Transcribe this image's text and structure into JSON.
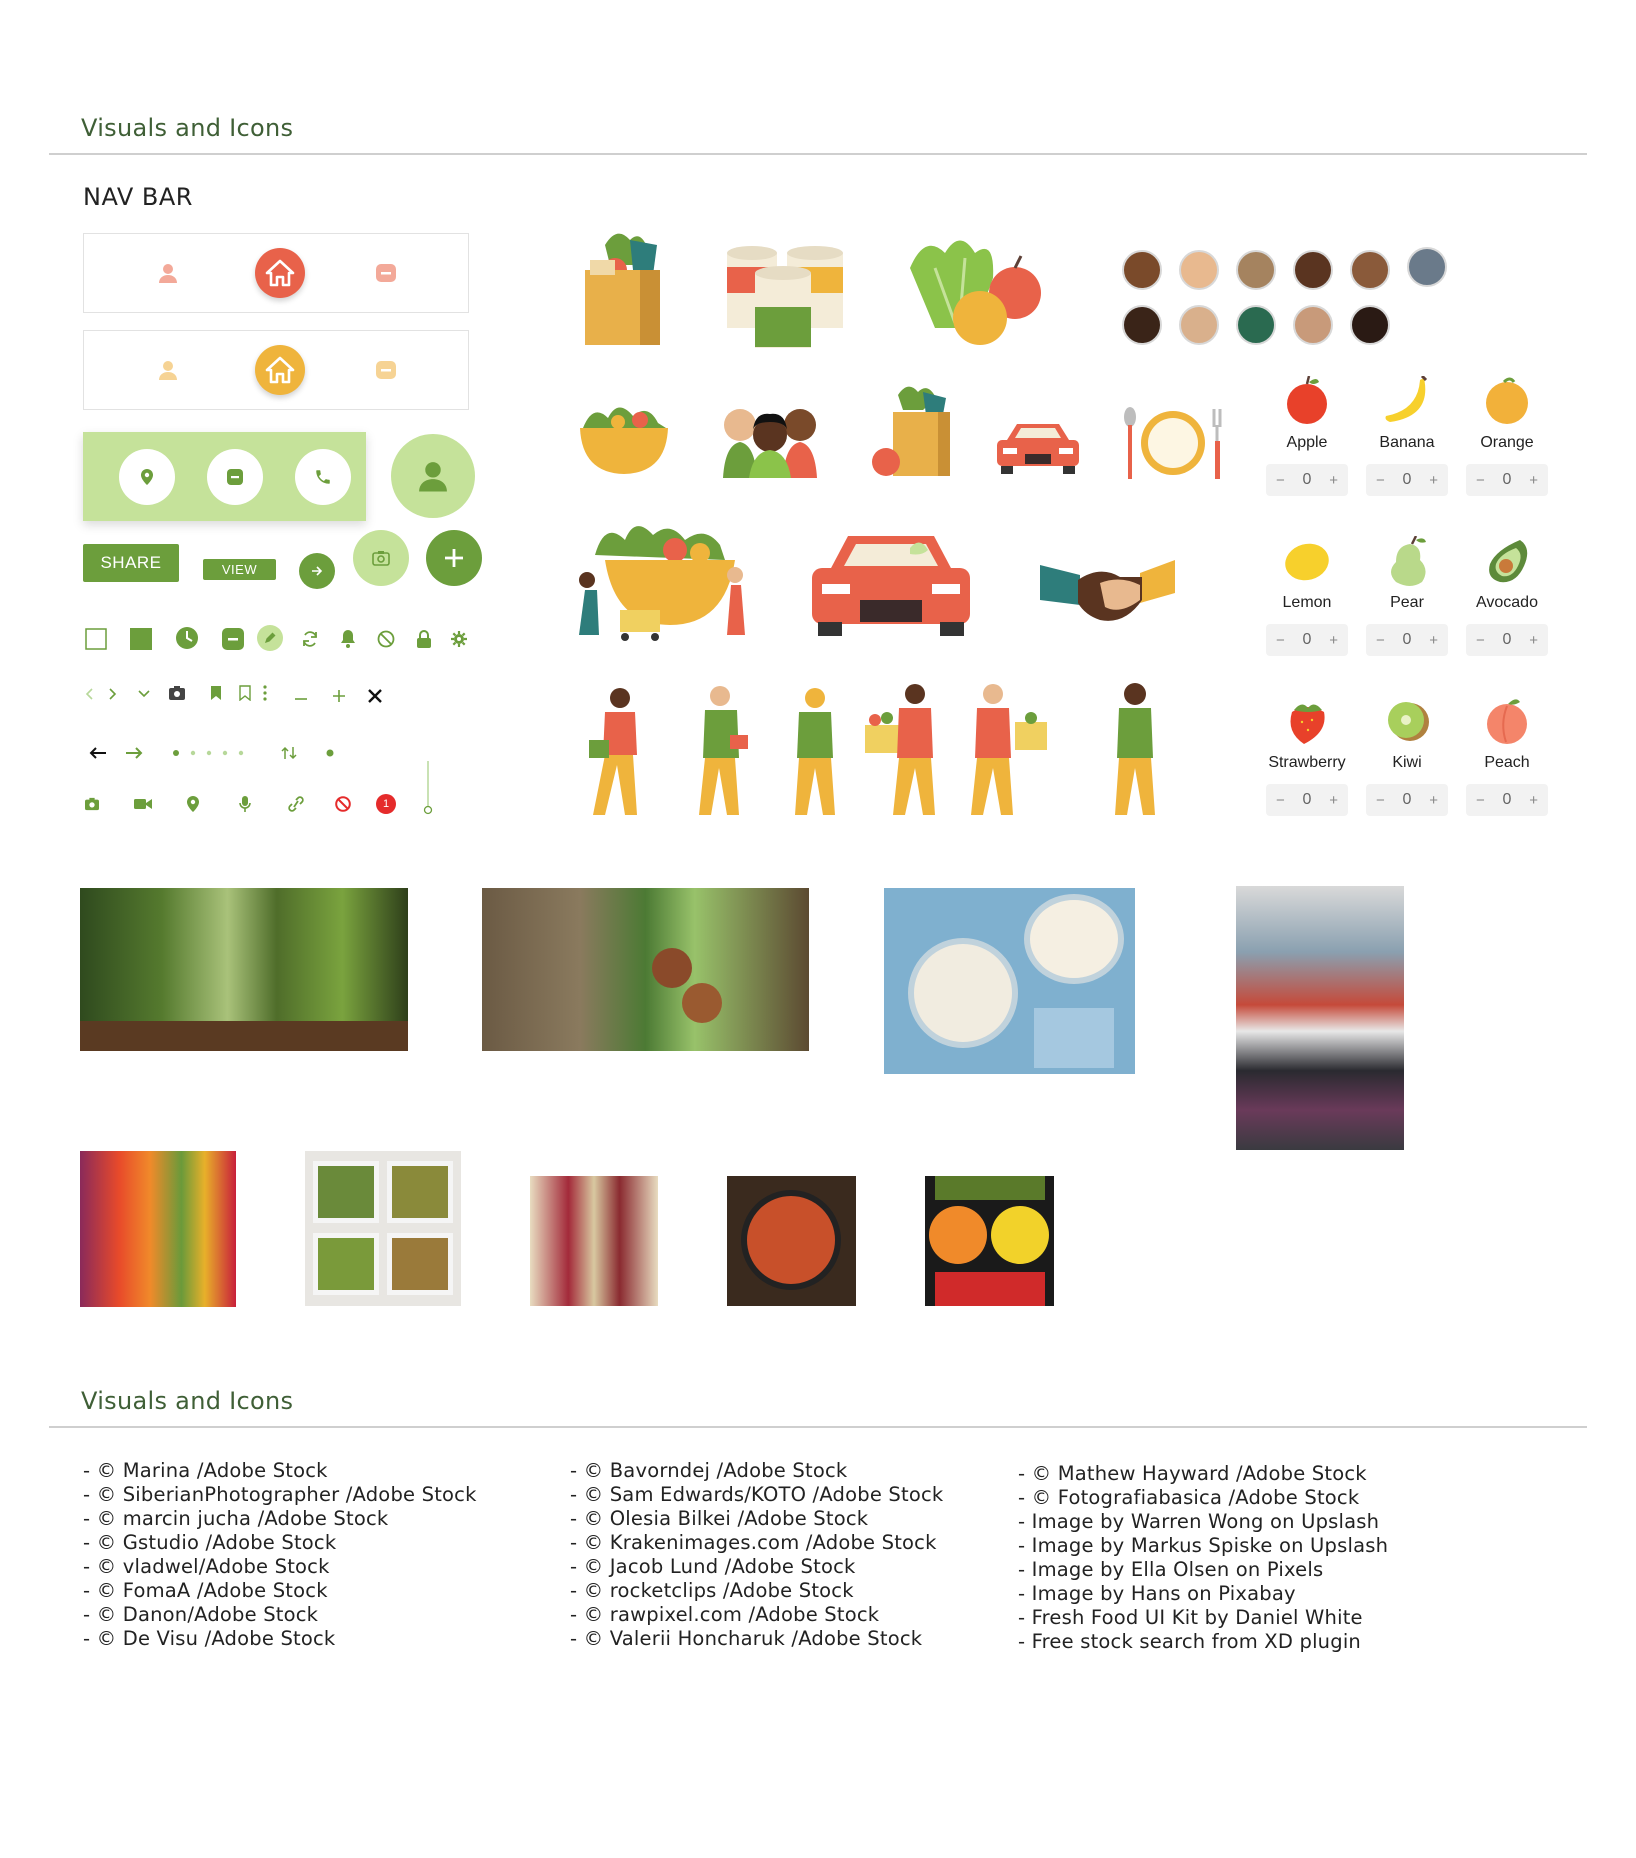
{
  "header": {
    "title": "Visuals and Icons"
  },
  "nav_section": {
    "title": "NAV BAR"
  },
  "navbars": [
    {
      "accent": "#e8624a",
      "soft": "#f3a999"
    },
    {
      "accent": "#efb43c",
      "soft": "#f6d394"
    }
  ],
  "buttons": {
    "share_label": "SHARE",
    "view_label": "VIEW"
  },
  "colors": {
    "green": "#6c9e3c",
    "light_green": "#c5e29a",
    "red": "#e8624a",
    "yellow": "#efb43c"
  },
  "fruits": [
    {
      "name": "Apple",
      "qty": "0",
      "minus": "−",
      "plus": "+"
    },
    {
      "name": "Banana",
      "qty": "0",
      "minus": "−",
      "plus": "+"
    },
    {
      "name": "Orange",
      "qty": "0",
      "minus": "−",
      "plus": "+"
    },
    {
      "name": "Lemon",
      "qty": "0",
      "minus": "−",
      "plus": "+"
    },
    {
      "name": "Pear",
      "qty": "0",
      "minus": "−",
      "plus": "+"
    },
    {
      "name": "Avocado",
      "qty": "0",
      "minus": "−",
      "plus": "+"
    },
    {
      "name": "Strawberry",
      "qty": "0",
      "minus": "−",
      "plus": "+"
    },
    {
      "name": "Kiwi",
      "qty": "0",
      "minus": "−",
      "plus": "+"
    },
    {
      "name": "Peach",
      "qty": "0",
      "minus": "−",
      "plus": "+"
    }
  ],
  "notification_badge": "1",
  "footer": {
    "title": "Visuals and Icons"
  },
  "credits": {
    "col1": [
      "- © Marina /Adobe Stock",
      "- © SiberianPhotographer /Adobe Stock",
      "- © marcin jucha /Adobe Stock",
      "- © Gstudio /Adobe Stock",
      "- © vladwel/Adobe Stock",
      "- © FomaA /Adobe Stock",
      "- © Danon/Adobe Stock",
      "- © De Visu /Adobe Stock"
    ],
    "col2": [
      "- © Bavorndej /Adobe Stock",
      "- © Sam Edwards/KOTO /Adobe Stock",
      "- © Olesia Bilkei /Adobe Stock",
      "- © Krakenimages.com /Adobe Stock",
      "- © Jacob Lund /Adobe Stock",
      "- © rocketclips /Adobe Stock",
      "- © rawpixel.com /Adobe Stock",
      "- © Valerii Honcharuk /Adobe Stock"
    ],
    "col3": [
      "- © Mathew Hayward /Adobe Stock",
      "- © Fotografiabasica /Adobe Stock",
      "- Image by Warren Wong on Upslash",
      "- Image by Markus Spiske on Upslash",
      "- Image by Ella Olsen on Pixels",
      "- Image by Hans on Pixabay",
      "- Fresh Food UI Kit by Daniel White",
      "- Free stock search from XD plugin"
    ]
  }
}
